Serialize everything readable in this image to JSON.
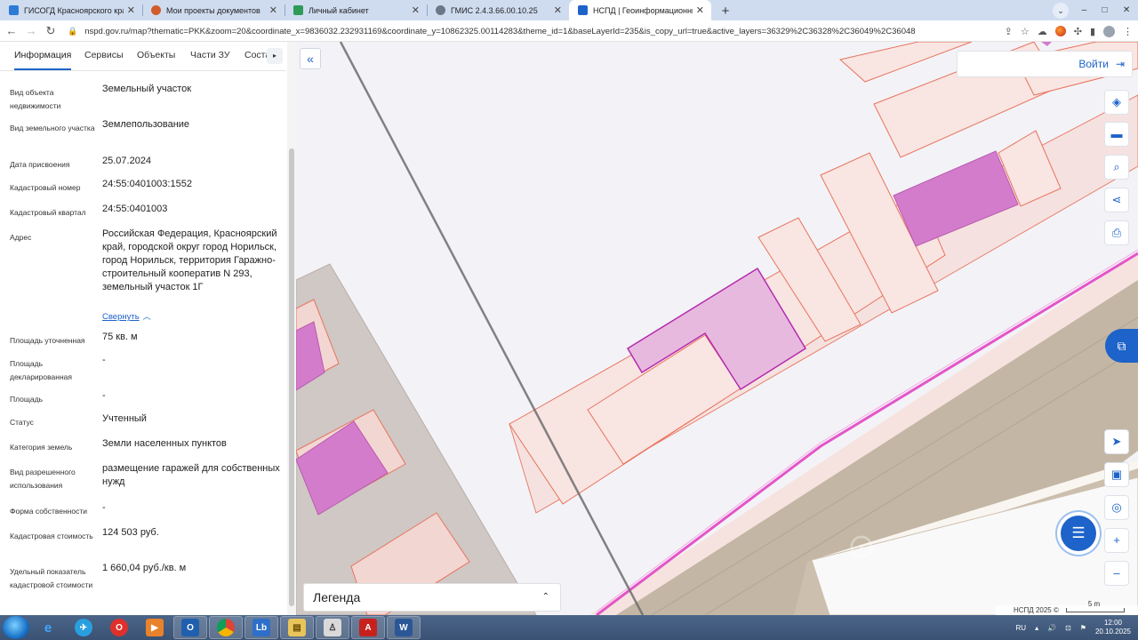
{
  "browser": {
    "tabs": [
      {
        "title": "ГИСОГД Красноярского края",
        "color": "#2d7bd6"
      },
      {
        "title": "Мои проекты документов",
        "color": "#d35b2b"
      },
      {
        "title": "Личный кабинет",
        "color": "#2e9b57"
      },
      {
        "title": "ГМИС 2.4.3.66.00.10.25",
        "color": "#6b7888"
      },
      {
        "title": "НСПД | Геоинформационный п",
        "color": "#1d63c9",
        "active": true
      }
    ],
    "new_tab": "+",
    "tab_menu": "⌄",
    "window_controls": [
      "–",
      "□",
      "✕"
    ],
    "nav": {
      "back": "←",
      "forward": "→",
      "reload": "↻"
    },
    "url": "nspd.gov.ru/map?thematic=PKK&zoom=20&coordinate_x=9836032.232931169&coordinate_y=10862325.00114283&theme_id=1&baseLayerId=235&is_copy_url=true&active_layers=36329%2C36328%2C36049%2C36048",
    "toolbar_icons": [
      "share-icon",
      "star-icon",
      "extension-icon",
      "puzzle-icon",
      "sidebar-icon",
      "profile-icon",
      "menu-icon"
    ]
  },
  "panel": {
    "tabs": [
      {
        "label": "Информация",
        "active": true
      },
      {
        "label": "Сервисы"
      },
      {
        "label": "Объекты"
      },
      {
        "label": "Части ЗУ"
      },
      {
        "label": "Соста"
      }
    ],
    "tabs_more": "▸",
    "properties": [
      {
        "label": "Вид объекта недвижимости",
        "value": "Земельный участок"
      },
      {
        "label": "Вид земельного участка",
        "value": "Землепользование"
      },
      {
        "label": "Дата присвоения",
        "value": "25.07.2024"
      },
      {
        "label": "Кадастровый номер",
        "value": "24:55:0401003:1552"
      },
      {
        "label": "Кадастровый квартал",
        "value": "24:55:0401003"
      },
      {
        "label": "Адрес",
        "value": "Российская Федерация, Красноярский край, городской округ город Норильск, город Норильск, территория Гаражно-строительный кооператив N 293, земельный участок 1Г"
      },
      {
        "label": "Площадь уточненная",
        "value": "75 кв. м"
      },
      {
        "label": "Площадь декларированная",
        "value": "-"
      },
      {
        "label": "Площадь",
        "value": "-"
      },
      {
        "label": "Статус",
        "value": "Учтенный"
      },
      {
        "label": "Категория земель",
        "value": "Земли населенных пунктов"
      },
      {
        "label": "Вид разрешенного использования",
        "value": "размещение гаражей для собственных нужд"
      },
      {
        "label": "Форма собственности",
        "value": "-"
      },
      {
        "label": "Кадастровая стоимость",
        "value": "124 503 руб."
      },
      {
        "label": "Удельный показатель кадастровой стоимости",
        "value": "1 660,04 руб./кв. м"
      }
    ],
    "collapse_link": "Свернуть"
  },
  "map": {
    "collapse_panel": "«",
    "login_label": "Войти",
    "right_tools": [
      "layers-icon",
      "ruler-icon",
      "search-area-icon",
      "share-icon",
      "print-icon"
    ],
    "bottom_tools": [
      "locate-icon",
      "minimap-icon",
      "geo-search-icon",
      "zoom-in-icon",
      "zoom-out-icon"
    ],
    "zoom_in": "+",
    "zoom_out": "–",
    "legend_label": "Легенда",
    "attribution": "НСПД 2025 ©",
    "scale_label": "5 m",
    "colors": {
      "parcel_fill": "#f8e2df",
      "parcel_stroke": "#e8735e",
      "selected_fill": "#e8b9de",
      "selected_stroke": "#b42ab0",
      "building": "#d47ccc",
      "road": "#c3b6a4"
    }
  },
  "taskbar": {
    "apps": [
      "IE",
      "↗",
      "O",
      "▶",
      "O",
      "●",
      "Lb",
      "▤",
      "♙",
      "A",
      "W"
    ],
    "lang": "RU",
    "time": "12:00",
    "date": "20.10.2025"
  }
}
